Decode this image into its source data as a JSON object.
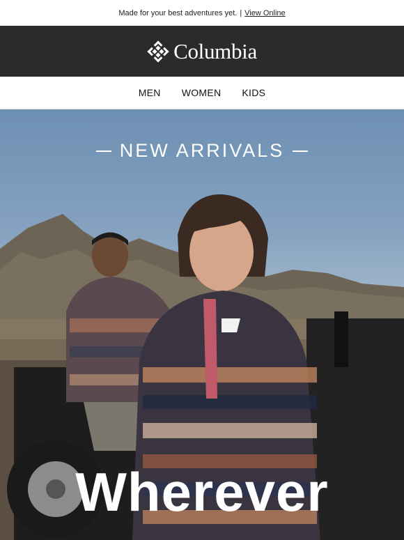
{
  "preheader": {
    "text": "Made for your best adventures yet.",
    "separator": "|",
    "link": "View Online"
  },
  "brand": {
    "logo_icon": "columbia-diamond-icon",
    "name": "Columbia"
  },
  "nav": {
    "items": [
      "MEN",
      "WOMEN",
      "KIDS"
    ]
  },
  "hero": {
    "title": "NEW ARRIVALS",
    "headline": "Wherever"
  },
  "colors": {
    "brand_bar": "#2b2b2b",
    "text_dark": "#111111",
    "white": "#ffffff"
  }
}
